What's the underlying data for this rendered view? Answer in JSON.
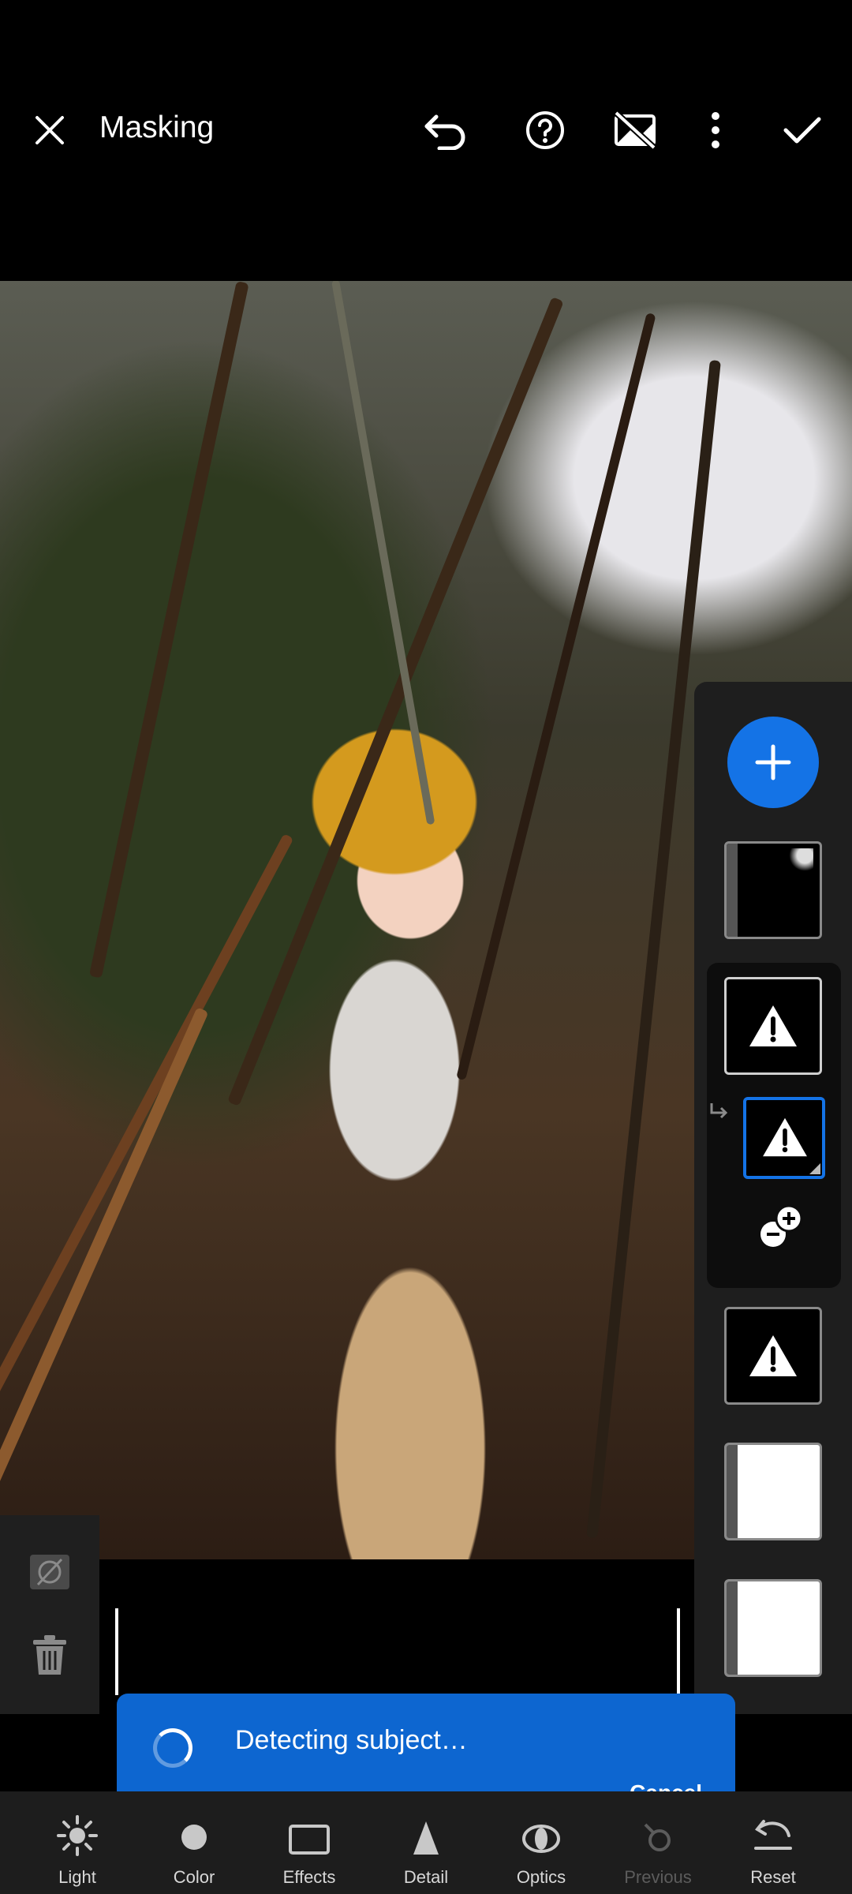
{
  "header": {
    "title": "Masking",
    "icons": [
      "close-icon",
      "undo-icon",
      "help-icon",
      "overlay-off-icon",
      "more-icon",
      "checkmark-icon"
    ]
  },
  "mask_panel": {
    "add_icon": "plus-icon",
    "masks": [
      {
        "kind": "partial"
      },
      {
        "kind": "warning",
        "selected_group": true
      },
      {
        "kind": "warning",
        "sub": true,
        "active": true
      },
      {
        "kind": "warning"
      },
      {
        "kind": "white"
      },
      {
        "kind": "white"
      }
    ]
  },
  "left_tools": [
    "mask-overlay-icon",
    "delete-icon"
  ],
  "toast": {
    "message": "Detecting subject…",
    "action": "Cancel",
    "color": "#0d66d0"
  },
  "nav": {
    "items": [
      {
        "label": "Light",
        "icon": "sun-icon"
      },
      {
        "label": "Color",
        "icon": "color-icon"
      },
      {
        "label": "Effects",
        "icon": "effects-icon"
      },
      {
        "label": "Detail",
        "icon": "detail-icon"
      },
      {
        "label": "Optics",
        "icon": "optics-icon"
      },
      {
        "label": "Previous",
        "icon": "previous-icon",
        "disabled": true
      },
      {
        "label": "Reset",
        "icon": "reset-icon"
      }
    ]
  },
  "accent_color": "#1473e6"
}
